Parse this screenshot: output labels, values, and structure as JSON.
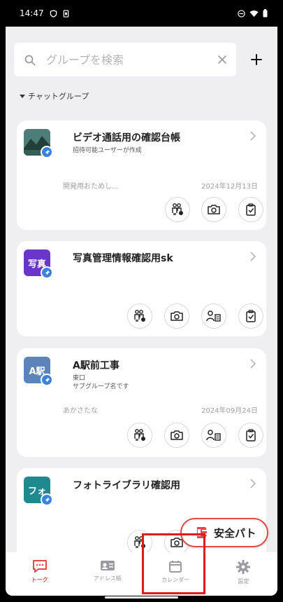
{
  "status_bar": {
    "time": "14:47"
  },
  "search": {
    "placeholder": "グループを検索"
  },
  "section": {
    "label": "チャットグループ"
  },
  "groups": [
    {
      "title": "ビデオ通話用の確認台帳",
      "subtitle": "招待可能ユーザーが作成",
      "last_message": "開発用おためし...",
      "date": "2024年12月13日",
      "avatar_text": ""
    },
    {
      "title": "写真管理情報確認用sk",
      "avatar_text": "写真"
    },
    {
      "title": "A駅前工事",
      "subtitle": "東口",
      "subtitle2": "サブグループ名です",
      "last_message": "あかさたな",
      "date": "2024年09月24日",
      "avatar_text": "A駅"
    },
    {
      "title": "フォトライブラリ確認用",
      "avatar_text": "フォ"
    }
  ],
  "safety_button": {
    "label": "安全パト"
  },
  "bottom_nav": [
    {
      "label": "トーク",
      "icon": "chat-icon",
      "active": true
    },
    {
      "label": "アドレス帳",
      "icon": "address-book-icon",
      "active": false
    },
    {
      "label": "カレンダー",
      "icon": "calendar-icon",
      "active": false
    },
    {
      "label": "設定",
      "icon": "gear-icon",
      "active": false
    }
  ],
  "colors": {
    "accent": "#e54848",
    "pin": "#3b82e0",
    "background": "#efeff1"
  }
}
